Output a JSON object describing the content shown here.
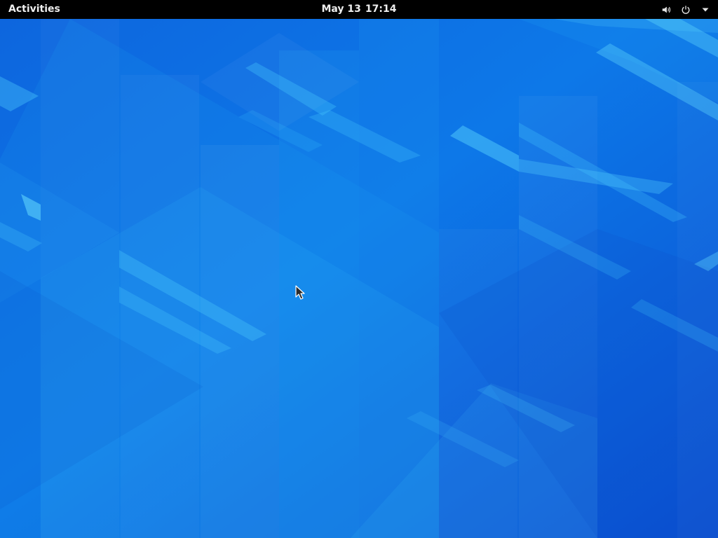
{
  "topbar": {
    "activities_label": "Activities",
    "date": "May 13",
    "time": "17:14",
    "icons": [
      "volume-icon",
      "power-icon",
      "chevron-down-icon"
    ]
  },
  "desktop": {
    "wallpaper": "blue-geometric",
    "colors": {
      "topbar_bg": "#000000",
      "topbar_text": "#eeeeee",
      "wallpaper_base": "#0b5fdc",
      "wallpaper_light": "#1aa0f0"
    }
  }
}
